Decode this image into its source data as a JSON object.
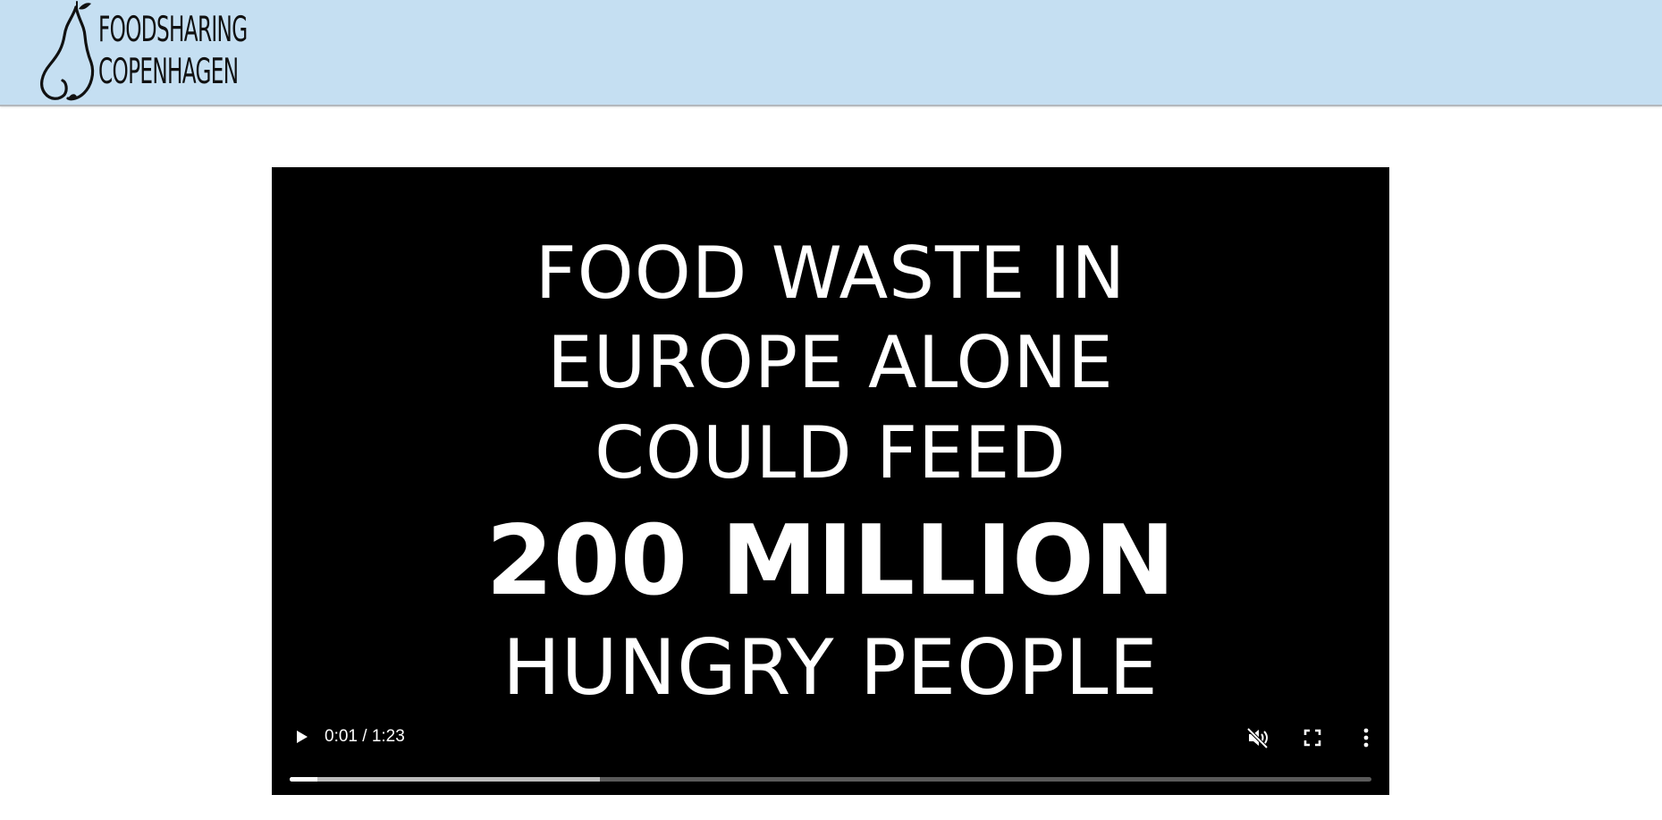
{
  "header": {
    "logo_line1": "FOODSHARING",
    "logo_line2": "COPENHAGEN",
    "background": "#c5dff2"
  },
  "video": {
    "slide_lines": [
      "FOOD WASTE IN",
      "EUROPE ALONE",
      "COULD FEED",
      "200 MILLION",
      "HUNGRY PEOPLE"
    ],
    "controls": {
      "time_display": "0:01 / 1:23",
      "played_fraction": 0.026,
      "buffered_fraction": 0.287,
      "icons": [
        "play-icon",
        "volume-muted-icon",
        "fullscreen-icon",
        "more-vertical-icon"
      ]
    }
  }
}
